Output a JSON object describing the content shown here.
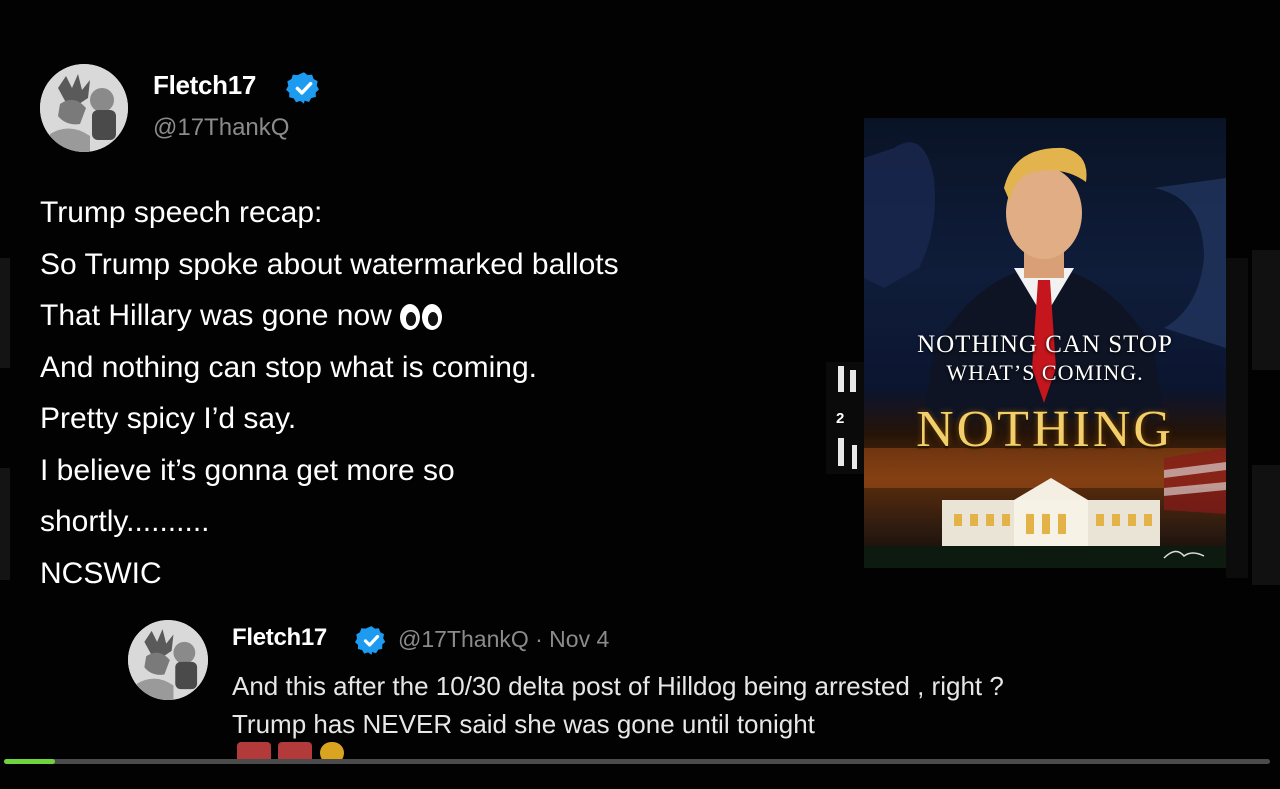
{
  "main_tweet": {
    "display_name": "Fletch17",
    "handle": "@17ThankQ",
    "lines": [
      "Trump speech recap:",
      "So Trump spoke about watermarked ballots",
      "That Hillary was gone now",
      "And nothing can stop what is coming.",
      "Pretty spicy I’d say.",
      "I believe it’s gonna get more so",
      "shortly..........",
      "NCSWIC"
    ],
    "emoji_icon": "eyes-icon"
  },
  "poster": {
    "headline_line1": "Nothing can stop",
    "headline_line2": "what’s coming.",
    "title": "Nothing"
  },
  "overlay": {
    "badge": "2"
  },
  "reply_tweet": {
    "display_name": "Fletch17",
    "handle_and_date": "@17ThankQ · Nov 4",
    "lines": [
      "And this after the 10/30 delta post of Hilldog being arrested , right ?",
      "Trump has NEVER said she was gone until tonight"
    ]
  },
  "video": {
    "progress": 0.04
  },
  "colors": {
    "verified": "#1d9bf0",
    "progress": "#6fd33f",
    "handle": "#8b8b8b",
    "title_gold": "#f2cf6a"
  }
}
